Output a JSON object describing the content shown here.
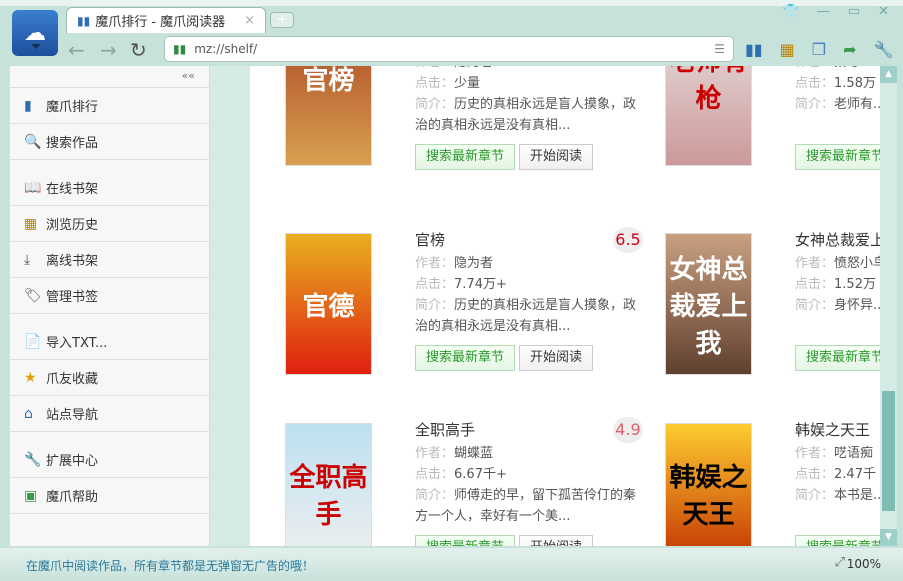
{
  "browser": {
    "tab_title": "魔爪排行 - 魔爪阅读器",
    "new_tab": "+",
    "address": "mz://shelf/"
  },
  "sidebar": {
    "collapse": "««",
    "items": [
      {
        "label": "魔爪排行",
        "icon": "chart-icon"
      },
      {
        "label": "搜索作品",
        "icon": "search-icon"
      },
      {
        "label": "在线书架",
        "icon": "book-icon"
      },
      {
        "label": "浏览历史",
        "icon": "history-icon"
      },
      {
        "label": "离线书架",
        "icon": "download-icon"
      },
      {
        "label": "管理书签",
        "icon": "tag-icon"
      },
      {
        "label": "导入TXT...",
        "icon": "file-icon"
      },
      {
        "label": "爪友收藏",
        "icon": "star-icon"
      },
      {
        "label": "站点导航",
        "icon": "home-icon"
      },
      {
        "label": "扩展中心",
        "icon": "wrench-icon"
      },
      {
        "label": "魔爪帮助",
        "icon": "help-icon"
      }
    ]
  },
  "labels": {
    "author": "作者：",
    "clicks": "点击：",
    "intro": "简介：",
    "search_btn": "搜索最新章节",
    "read_btn": "开始阅读"
  },
  "books": [
    {
      "title": "",
      "score": "",
      "author": "隐为者",
      "clicks": "少量",
      "intro": "历史的真相永远是盲人摸象，政治的真相永远是没有真相...",
      "cover": "官榜"
    },
    {
      "title": "",
      "score": "",
      "author": "鹅考",
      "clicks": "1.58万",
      "intro": "老师有...拓和他失散多...",
      "cover": "老师有枪"
    },
    {
      "title": "官榜",
      "score": "6.5",
      "author": "隐为者",
      "clicks": "7.74万+",
      "intro": "历史的真相永远是盲人摸象，政治的真相永远是没有真相...",
      "cover": "官德"
    },
    {
      "title": "女神总裁爱上我",
      "score": "",
      "author": "愤怒小鸟",
      "clicks": "1.52万",
      "intro": "身怀异...保安，与美若...",
      "cover": "女神总裁爱上我"
    },
    {
      "title": "全职高手",
      "score": "4.9",
      "author": "蝴蝶蓝",
      "clicks": "6.67千+",
      "intro": "师傅走的早，留下孤苦伶仃的秦方一个人，幸好有一个美...",
      "cover": "全职高手"
    },
    {
      "title": "韩娱之天王",
      "score": "",
      "author": "呓语痴",
      "clicks": "2.47千",
      "intro": "本书是...乐圈的YY，不...",
      "cover": "韩娱之天王"
    }
  ],
  "status": {
    "message": "在魔爪中阅读作品，所有章节都是无弹窗无广告的哦！",
    "zoom": "100%"
  }
}
